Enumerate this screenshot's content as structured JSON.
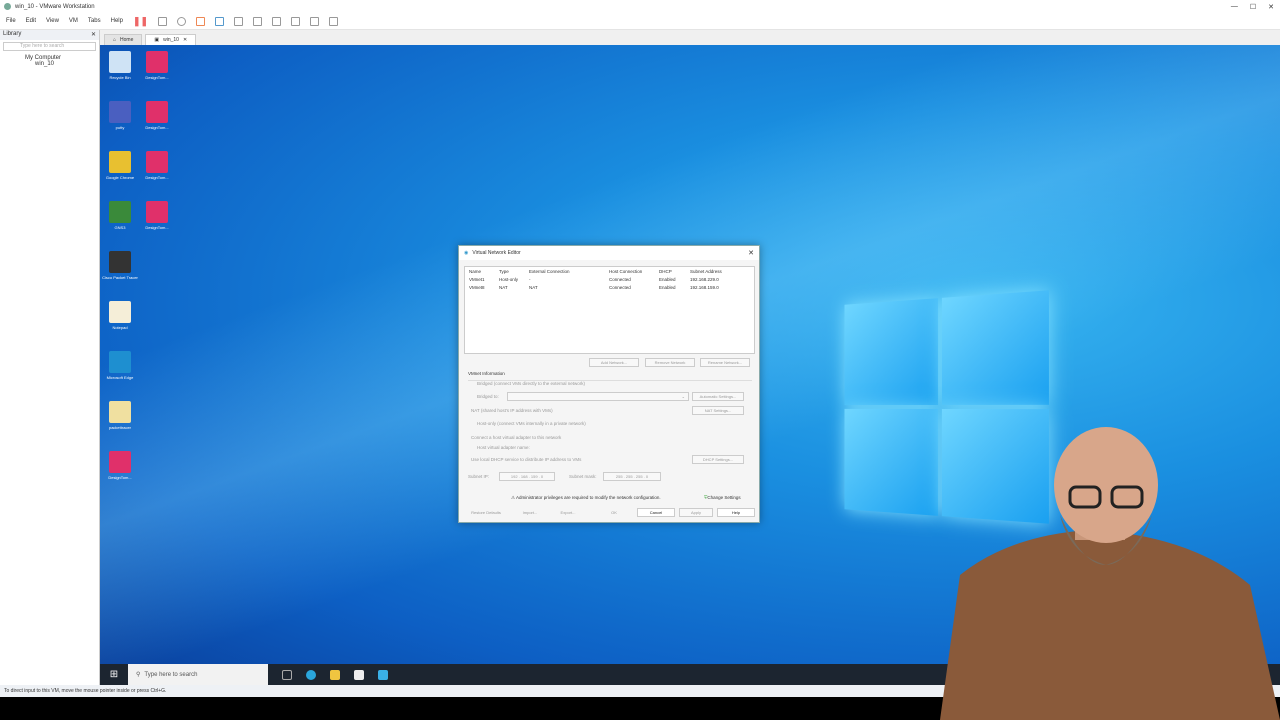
{
  "window": {
    "title": "win_10 - VMware Workstation",
    "controls": [
      "—",
      "☐",
      "✕"
    ]
  },
  "menu": [
    "File",
    "Edit",
    "View",
    "VM",
    "Tabs",
    "Help"
  ],
  "library": {
    "title": "Library",
    "search_placeholder": "Type here to search",
    "tree": [
      "My Computer",
      "win_10"
    ]
  },
  "tabs": [
    {
      "label": "Home"
    },
    {
      "label": "win_10"
    }
  ],
  "desktop_icons": [
    {
      "label": "Recycle Bin",
      "color": "#cfe3f5"
    },
    {
      "label": "DesignTom...",
      "color": "#e0306a"
    },
    {
      "label": "putty",
      "color": "#4a5fc0"
    },
    {
      "label": "DesignTom...",
      "color": "#e0306a"
    },
    {
      "label": "Google Chrome",
      "color": "#e8c030"
    },
    {
      "label": "DesignTom...",
      "color": "#e0306a"
    },
    {
      "label": "GNS3",
      "color": "#3a8a3a"
    },
    {
      "label": "DesignTom...",
      "color": "#e0306a"
    },
    {
      "label": "Cisco Packet Tracer",
      "color": "#333"
    },
    {
      "label": "Notepad",
      "color": "#f5eed8"
    },
    {
      "label": "Microsoft Edge",
      "color": "#1e8fd0"
    },
    {
      "label": "packettracer",
      "color": "#f0e0a0"
    },
    {
      "label": "DesignTom...",
      "color": "#e0306a"
    }
  ],
  "taskbar": {
    "search_placeholder": "Type here to search"
  },
  "status": "To direct input to this VM, move the mouse pointer inside or press Ctrl+G.",
  "dialog": {
    "title": "Virtual Network Editor",
    "columns": [
      "Name",
      "Type",
      "External Connection",
      "Host Connection",
      "DHCP",
      "Subnet Address"
    ],
    "rows": [
      [
        "VMnet1",
        "Host-only",
        "-",
        "Connected",
        "Enabled",
        "192.168.229.0"
      ],
      [
        "VMnet8",
        "NAT",
        "NAT",
        "Connected",
        "Enabled",
        "192.168.159.0"
      ]
    ],
    "list_buttons": [
      "Add Network...",
      "Remove Network",
      "Rename Network..."
    ],
    "info_title": "VMnet Information",
    "bridged": "Bridged (connect VMs directly to the external network)",
    "bridged_to": "Bridged to:",
    "auto_settings": "Automatic Settings...",
    "nat": "NAT (shared host's IP address with VMs)",
    "nat_settings": "NAT Settings...",
    "hostonly": "Host-only (connect VMs internally in a private network)",
    "connect_adapter": "Connect a host virtual adapter to this network",
    "adapter_name": "Host virtual adapter name:",
    "dhcp": "Use local DHCP service to distribute IP address to VMs",
    "dhcp_settings": "DHCP Settings...",
    "subnet_ip_label": "Subnet IP:",
    "subnet_ip": "192 . 168 . 159 . 0",
    "subnet_mask_label": "Subnet mask:",
    "subnet_mask": "255 . 255 . 255 . 0",
    "admin_warning": "Administrator privileges are required to modify the network configuration.",
    "change_settings": "Change Settings",
    "footer": [
      "Restore Defaults",
      "Import...",
      "Export...",
      "OK",
      "Cancel",
      "Apply",
      "Help"
    ]
  }
}
